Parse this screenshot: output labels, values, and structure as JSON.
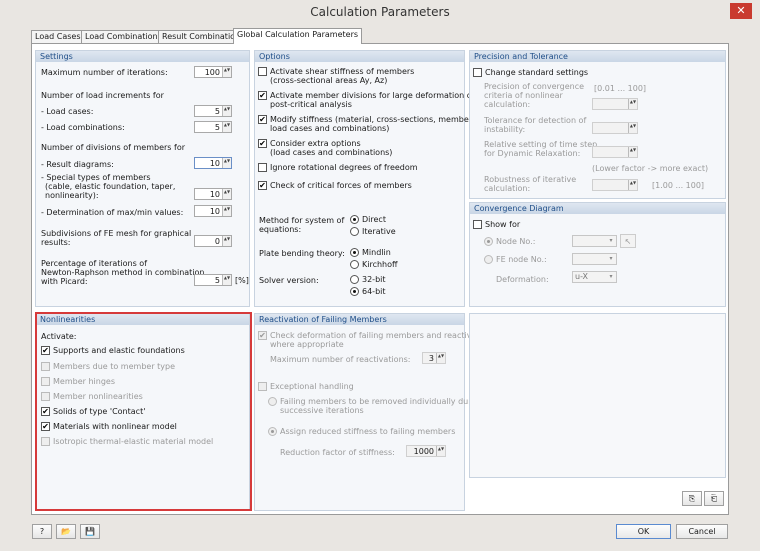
{
  "window": {
    "title": "Calculation Parameters",
    "close_glyph": "✕"
  },
  "tabs": [
    "Load Cases",
    "Load Combinations",
    "Result Combinations",
    "Global Calculation Parameters"
  ],
  "settings": {
    "title": "Settings",
    "max_iter_label": "Maximum number of iterations:",
    "max_iter": "100",
    "load_incr_label": "Number of load increments for",
    "load_cases_label": "- Load cases:",
    "load_cases": "5",
    "load_combos_label": "- Load combinations:",
    "load_combos": "5",
    "divisions_label": "Number of divisions of members for",
    "result_diagrams_label": "- Result diagrams:",
    "result_diagrams": "10",
    "special_label1": "- Special types of members",
    "special_label2": "(cable, elastic foundation, taper,",
    "special_label3": "nonlinearity):",
    "special": "10",
    "maxmin_label": "- Determination of max/min values:",
    "maxmin": "10",
    "subdiv_label1": "Subdivisions of FE mesh for graphical",
    "subdiv_label2": "results:",
    "subdiv": "0",
    "pct_label1": "Percentage of iterations of",
    "pct_label2": "Newton-Raphson method in combination",
    "pct_label3": "with Picard:",
    "pct": "5",
    "pct_unit": "[%]"
  },
  "options": {
    "title": "Options",
    "o1a": "Activate shear stiffness of members",
    "o1b": "(cross-sectional areas Ay, Az)",
    "o2a": "Activate member divisions for large deformation or",
    "o2b": "post-critical analysis",
    "o3a": "Modify stiffness (material, cross-sections, members,",
    "o3b": "load cases and combinations)",
    "o4a": "Consider extra options",
    "o4b": "(load cases and combinations)",
    "o5": "Ignore rotational degrees of freedom",
    "o6": "Check of critical forces of members",
    "method_label1": "Method for system of",
    "method_label2": "equations:",
    "method_direct": "Direct",
    "method_iterative": "Iterative",
    "plate_label": "Plate bending theory:",
    "plate_mindlin": "Mindlin",
    "plate_kirchhoff": "Kirchhoff",
    "solver_label": "Solver version:",
    "solver_32": "32-bit",
    "solver_64": "64-bit"
  },
  "precision": {
    "title": "Precision and Tolerance",
    "change_label": "Change standard settings",
    "range1": "[0.01 ... 100]",
    "p1a": "Precision of convergence",
    "p1b": "criteria of nonlinear",
    "p1c": "calculation:",
    "p2a": "Tolerance for detection of",
    "p2b": "instability:",
    "p3a": "Relative setting of time step",
    "p3b": "for Dynamic Relaxation:",
    "lower_hint": "(Lower factor -> more exact)",
    "p4a": "Robustness of iterative",
    "p4b": "calculation:",
    "range2": "[1.00 ... 100]"
  },
  "convergence": {
    "title": "Convergence Diagram",
    "show_for": "Show for",
    "node_no": "Node No.:",
    "fe_node_no": "FE node No.:",
    "deformation": "Deformation:",
    "deformation_value": "u-X"
  },
  "nonlinearities": {
    "title": "Nonlinearities",
    "activate": "Activate:",
    "items": [
      {
        "label": "Supports and elastic foundations",
        "checked": "✔"
      },
      {
        "label": "Members due to member type",
        "checked": ""
      },
      {
        "label": "Member hinges",
        "checked": ""
      },
      {
        "label": "Member nonlinearities",
        "checked": ""
      },
      {
        "label": "Solids of type 'Contact'",
        "checked": "✔"
      },
      {
        "label": "Materials with nonlinear model",
        "checked": "✔"
      },
      {
        "label": "Isotropic thermal-elastic material model",
        "checked": ""
      }
    ]
  },
  "reactivation": {
    "title": "Reactivation of Failing Members",
    "check_a": "Check deformation of failing members and reactivate",
    "check_b": "where appropriate",
    "max_label": "Maximum number of reactivations:",
    "max_value": "3",
    "exceptional": "Exceptional handling",
    "r1a": "Failing members to be removed individually during",
    "r1b": "successive iterations",
    "r2": "Assign reduced stiffness to failing members",
    "factor_label": "Reduction factor of stiffness:",
    "factor_value": "1000"
  },
  "footer": {
    "ok": "OK",
    "cancel": "Cancel"
  },
  "icons": {
    "check": "✔",
    "spin": "▲▼",
    "dropdown": "▾"
  }
}
